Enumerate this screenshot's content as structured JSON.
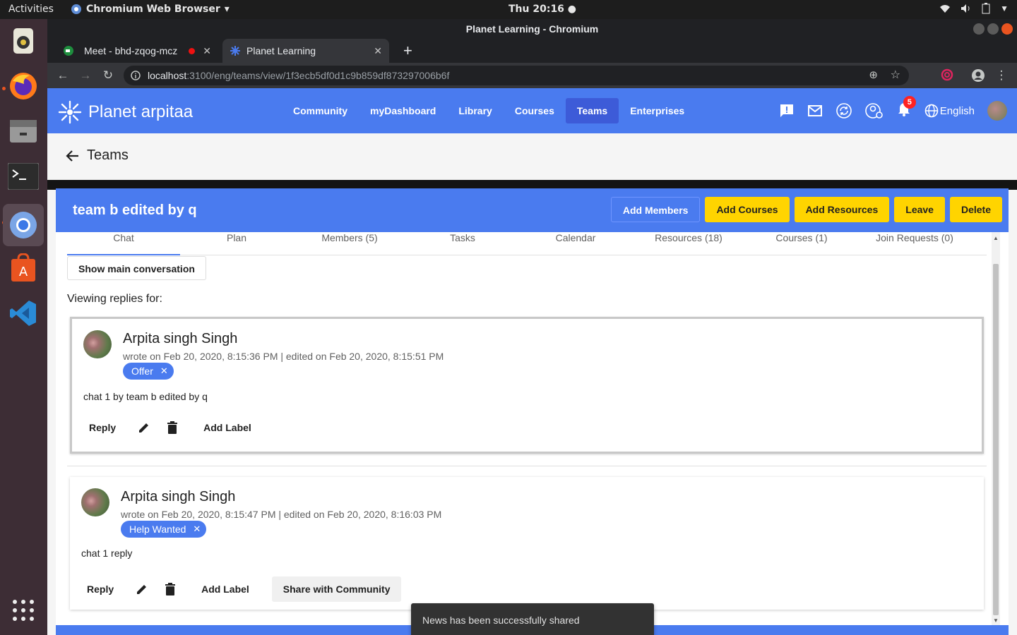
{
  "system": {
    "activities": "Activities",
    "app_name": "Chromium Web Browser",
    "clock": "Thu 20:16 ●"
  },
  "window": {
    "title": "Planet Learning - Chromium"
  },
  "browser": {
    "tabs": [
      {
        "label": "Meet - bhd-zqog-mcz"
      },
      {
        "label": "Planet Learning"
      }
    ],
    "url_host": "localhost",
    "url_path": ":3100/eng/teams/view/1f3ecb5df0d1c9b859df873297006b6f"
  },
  "app": {
    "brand": "Planet arpitaa",
    "nav": [
      "Community",
      "myDashboard",
      "Library",
      "Courses",
      "Teams",
      "Enterprises"
    ],
    "active_nav": "Teams",
    "notification_count": "5",
    "language": "English",
    "page_title": "Teams"
  },
  "team": {
    "name": "team b edited by q",
    "buttons": {
      "add_members": "Add Members",
      "add_courses": "Add Courses",
      "add_resources": "Add Resources",
      "leave": "Leave",
      "delete": "Delete"
    },
    "tabs": [
      "Chat",
      "Plan",
      "Members (5)",
      "Tasks",
      "Calendar",
      "Resources (18)",
      "Courses (1)",
      "Join Requests (0)"
    ],
    "active_tab": "Chat",
    "show_main": "Show main conversation",
    "viewing": "Viewing replies for:"
  },
  "posts": [
    {
      "author": "Arpita singh Singh",
      "meta": "wrote on Feb 20, 2020, 8:15:36 PM | edited on Feb 20, 2020, 8:15:51 PM",
      "label": "Offer",
      "text": "chat 1 by team b edited by q",
      "reply": "Reply",
      "add_label": "Add Label"
    },
    {
      "author": "Arpita singh Singh",
      "meta": "wrote on Feb 20, 2020, 8:15:47 PM | edited on Feb 20, 2020, 8:16:03 PM",
      "label": "Help Wanted",
      "text": "chat 1 reply",
      "reply": "Reply",
      "add_label": "Add Label",
      "share": "Share with Community"
    }
  ],
  "snackbar": "News has been successfully shared",
  "colors": {
    "primary": "#4a7bef",
    "accent": "#ffd400",
    "navbar_active": "#3d5bd8"
  }
}
